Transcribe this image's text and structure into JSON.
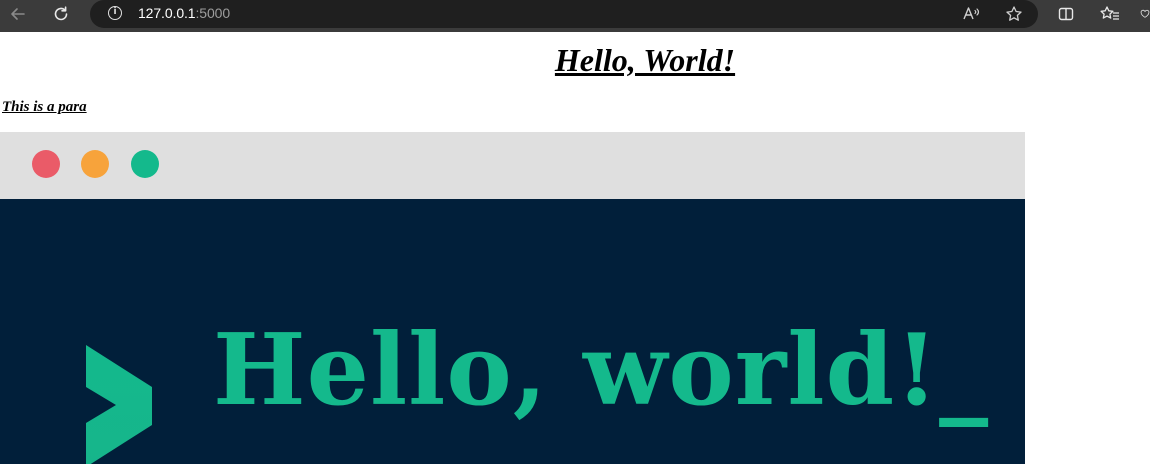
{
  "browser": {
    "url_host": "127.0.0.1",
    "url_port": ":5000",
    "icons": {
      "back": "back-arrow-icon",
      "reload": "reload-icon",
      "site_info": "info-icon",
      "read_aloud": "read-aloud-icon",
      "favorite": "star-icon",
      "split_screen": "split-screen-icon",
      "favorites_list": "favorites-icon",
      "copilot": "heart-icon"
    }
  },
  "page": {
    "heading": "Hello, World!",
    "paragraph": "This is a para"
  },
  "hero": {
    "text": "Hello, world!_",
    "colors": {
      "titlebar": "#dfdfdf",
      "background": "#011f3a",
      "accent": "#14b98c",
      "dot_red": "#ea5b68",
      "dot_orange": "#f7a33b",
      "dot_green": "#14b98c"
    }
  }
}
